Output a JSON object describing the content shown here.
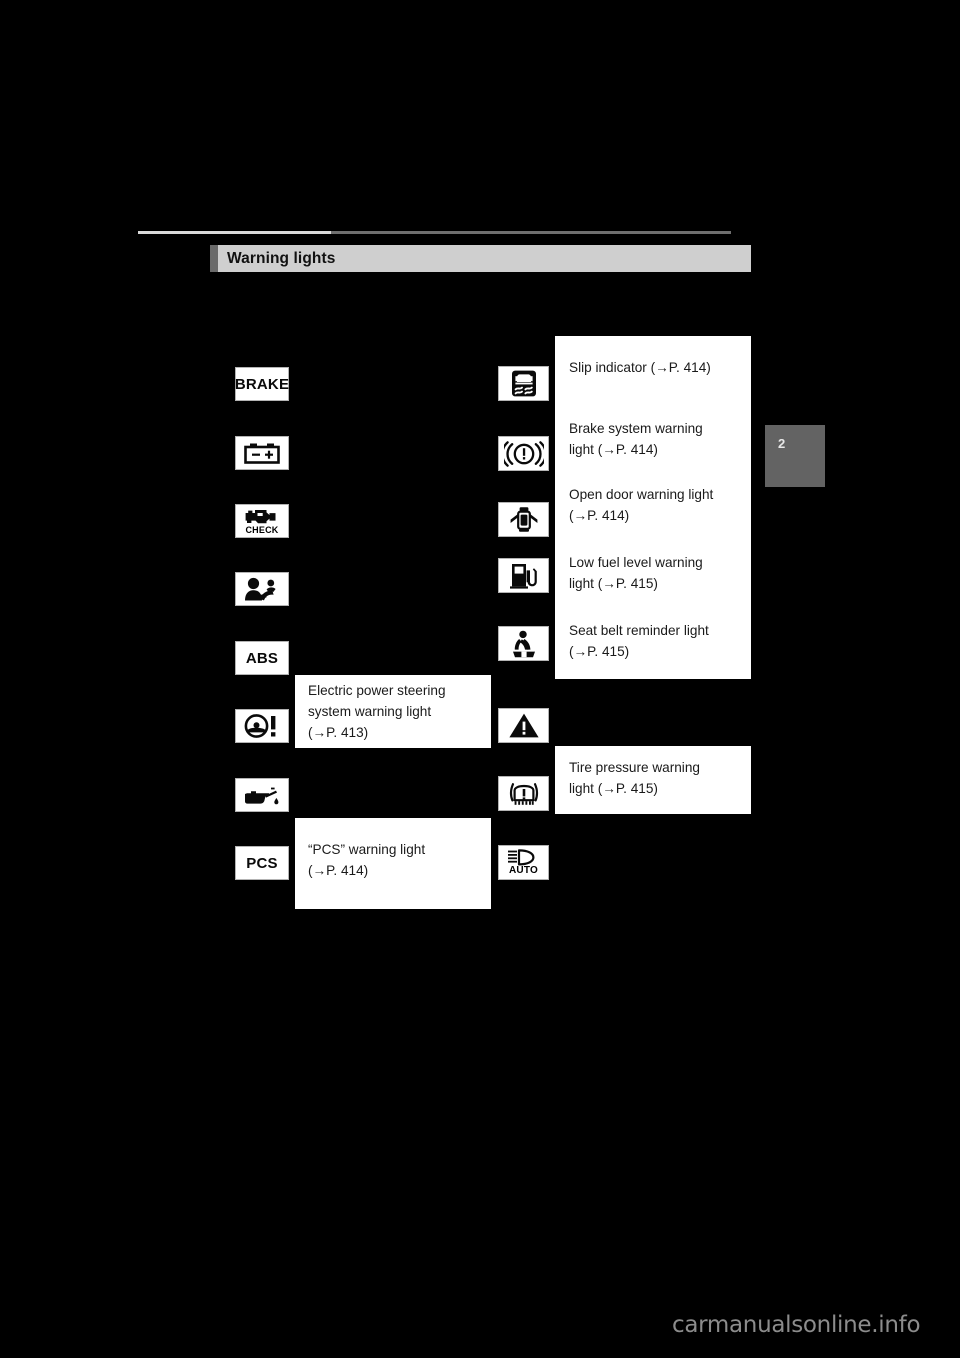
{
  "page": {
    "chapter_tab": "2",
    "watermark": "carmanualsonline.info"
  },
  "section": {
    "title": "Warning lights"
  },
  "left_column": {
    "icons": [
      {
        "name": "brake-warning-light",
        "label": "BRAKE",
        "kind": "text"
      },
      {
        "name": "charging-system-warning-light",
        "label": "",
        "kind": "battery"
      },
      {
        "name": "malfunction-indicator-lamp",
        "label": "CHECK",
        "kind": "check-engine"
      },
      {
        "name": "srs-airbag-warning-light",
        "label": "",
        "kind": "airbag"
      },
      {
        "name": "abs-warning-light",
        "label": "ABS",
        "kind": "text"
      },
      {
        "name": "electric-power-steering-warning-light",
        "label": "",
        "kind": "steering"
      },
      {
        "name": "low-engine-oil-pressure-warning-light",
        "label": "",
        "kind": "oil-can"
      },
      {
        "name": "pcs-warning-light",
        "label": "PCS",
        "kind": "text"
      }
    ]
  },
  "right_column": {
    "icons": [
      {
        "name": "slip-indicator-light",
        "label": "",
        "kind": "slip"
      },
      {
        "name": "brake-system-warning-light",
        "label": "",
        "kind": "brake-circle"
      },
      {
        "name": "open-door-warning-light",
        "label": "",
        "kind": "open-door"
      },
      {
        "name": "low-fuel-level-warning-light",
        "label": "",
        "kind": "fuel-pump"
      },
      {
        "name": "seat-belt-reminder-light",
        "label": "",
        "kind": "seat-belt"
      },
      {
        "name": "master-warning-light",
        "label": "",
        "kind": "triangle-warning"
      },
      {
        "name": "tire-pressure-warning-light",
        "label": "",
        "kind": "tire-pressure"
      },
      {
        "name": "auto-headlight-indicator",
        "label": "AUTO",
        "kind": "auto-headlight"
      }
    ]
  },
  "callouts": {
    "slip_indicator": {
      "line1": "Slip indicator (→P. 414)"
    },
    "brake_system": {
      "line1": "Brake    system    warning",
      "line2": "light (→P. 414)"
    },
    "open_door": {
      "line1": "Open door warning light",
      "line2": "(→P. 414)"
    },
    "low_fuel": {
      "line1": "Low   fuel   level   warning",
      "line2": "light (→P. 415)"
    },
    "seat_belt": {
      "line1": "Seat belt reminder light",
      "line2": "(→P. 415)"
    },
    "electric_power_steering": {
      "line1": "Electric   power   steering",
      "line2": "system warning light",
      "line3": "(→P. 413)"
    },
    "tire_pressure": {
      "line1": "Tire    pressure    warning",
      "line2": "light (→P. 415)"
    },
    "pcs": {
      "line1": "“PCS” warning light",
      "line2": "(→P. 414)"
    }
  }
}
